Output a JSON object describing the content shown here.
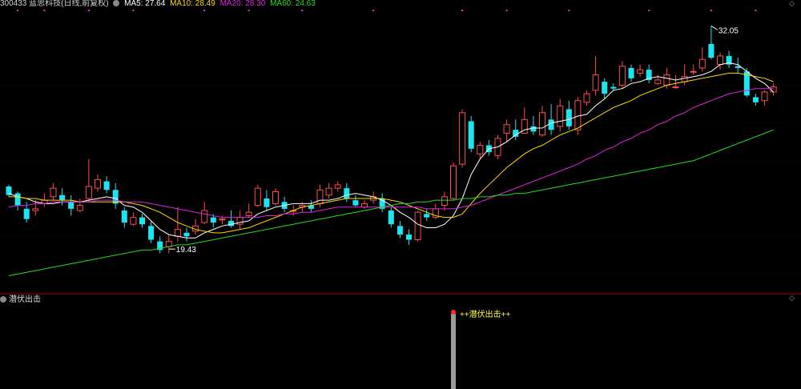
{
  "header": {
    "code_name": "300433 蓝思科技(日线,前复权)",
    "ma5_label": "MA5: 27.64",
    "ma10_label": "MA10: 28.49",
    "ma20_label": "MA20: 28.30",
    "ma60_label": "MA60: 24.63"
  },
  "sub_header": {
    "indicator_name": "潜伏出击"
  },
  "colors": {
    "up": "#ff4b4b",
    "down": "#19e6f0",
    "ma5": "#ffffff",
    "ma10": "#ffd800",
    "ma20": "#e020e0",
    "ma60": "#22dd22",
    "grid": "#4a0000",
    "signal": "#ffff30",
    "bar": "#9a9a9a",
    "marker": "#d040d0"
  },
  "chart_data": [
    {
      "type": "candlestick",
      "title": "300433 蓝思科技(日线,前复权)",
      "ylim": [
        16.5,
        33.0
      ],
      "annotations": [
        {
          "label": "32.05",
          "index": 79,
          "value": 32.05
        },
        {
          "label": "19.43",
          "index": 18,
          "value": 19.43
        }
      ],
      "series": [
        {
          "name": "K",
          "candles": [
            [
              22.7,
              22.7,
              22.2,
              22.1,
              22.8
            ],
            [
              22.2,
              22.3,
              21.6,
              21.3,
              22.4
            ],
            [
              21.6,
              21.4,
              20.8,
              20.6,
              21.8
            ],
            [
              21.2,
              21.3,
              21.4,
              21.0,
              21.9
            ],
            [
              21.4,
              21.7,
              21.9,
              21.5,
              22.3
            ],
            [
              21.8,
              22.1,
              22.6,
              21.9,
              22.9
            ],
            [
              22.4,
              22.2,
              21.9,
              21.6,
              22.6
            ],
            [
              22.1,
              21.8,
              21.4,
              21.0,
              22.2
            ],
            [
              21.7,
              21.3,
              21.6,
              21.2,
              22.0
            ],
            [
              21.9,
              22.0,
              22.7,
              21.8,
              24.3
            ],
            [
              22.5,
              22.6,
              23.1,
              22.4,
              23.4
            ],
            [
              23.2,
              23.0,
              22.5,
              22.3,
              23.3
            ],
            [
              22.7,
              22.5,
              21.7,
              21.4,
              22.9
            ],
            [
              21.7,
              21.3,
              20.6,
              20.3,
              21.5
            ],
            [
              20.7,
              20.5,
              20.9,
              20.4,
              21.2
            ],
            [
              21.0,
              20.9,
              20.5,
              20.3,
              21.1
            ],
            [
              20.5,
              20.4,
              19.6,
              19.4,
              20.7
            ],
            [
              19.7,
              19.5,
              19.0,
              18.8,
              19.8
            ],
            [
              19.3,
              19.2,
              19.5,
              18.8,
              19.9
            ],
            [
              19.6,
              19.8,
              20.2,
              19.5,
              21.5
            ],
            [
              20.1,
              20.0,
              19.8,
              19.5,
              20.3
            ],
            [
              20.0,
              20.1,
              20.4,
              19.9,
              20.8
            ],
            [
              20.4,
              20.6,
              21.3,
              20.5,
              21.8
            ],
            [
              21.0,
              20.9,
              20.6,
              20.3,
              21.1
            ],
            [
              20.7,
              20.8,
              20.8,
              20.5,
              21.0
            ],
            [
              20.8,
              20.7,
              20.4,
              20.3,
              21.3
            ],
            [
              20.8,
              20.5,
              20.9,
              20.2,
              21.3
            ],
            [
              20.9,
              21.0,
              21.2,
              20.9,
              21.7
            ],
            [
              21.2,
              21.6,
              22.6,
              21.5,
              22.8
            ],
            [
              22.3,
              22.0,
              21.5,
              21.3,
              22.5
            ],
            [
              21.6,
              21.7,
              22.4,
              21.6,
              22.6
            ],
            [
              22.2,
              21.8,
              21.4,
              21.2,
              22.1
            ],
            [
              21.5,
              21.3,
              21.3,
              21.0,
              21.6
            ],
            [
              21.4,
              21.5,
              21.6,
              21.2,
              21.8
            ],
            [
              21.7,
              21.6,
              21.4,
              21.2,
              21.9
            ],
            [
              21.5,
              21.7,
              22.5,
              21.5,
              22.8
            ],
            [
              22.3,
              22.2,
              22.6,
              22.0,
              22.9
            ],
            [
              22.6,
              22.6,
              22.8,
              22.4,
              23.0
            ],
            [
              22.7,
              22.6,
              22.0,
              21.8,
              22.9
            ],
            [
              22.0,
              21.9,
              21.6,
              21.5,
              22.2
            ],
            [
              21.6,
              21.5,
              21.7,
              21.4,
              21.9
            ],
            [
              21.8,
              21.9,
              22.1,
              21.7,
              22.4
            ],
            [
              22.1,
              22.0,
              21.4,
              21.2,
              22.3
            ],
            [
              21.4,
              21.3,
              20.5,
              20.3,
              21.5
            ],
            [
              20.6,
              20.4,
              19.9,
              19.7,
              20.7
            ],
            [
              19.8,
              19.9,
              19.6,
              19.3,
              20.2
            ],
            [
              19.9,
              19.6,
              21.2,
              19.5,
              21.3
            ],
            [
              21.2,
              21.1,
              20.9,
              20.7,
              21.4
            ],
            [
              20.9,
              20.9,
              21.4,
              20.8,
              21.7
            ],
            [
              21.5,
              21.6,
              22.1,
              21.3,
              22.4
            ],
            [
              22.1,
              22.0,
              23.9,
              21.9,
              24.1
            ],
            [
              23.9,
              24.0,
              27.0,
              23.8,
              27.2
            ],
            [
              26.7,
              26.5,
              24.9,
              24.7,
              26.8
            ],
            [
              24.9,
              24.6,
              25.1,
              24.3,
              25.3
            ],
            [
              24.9,
              25.1,
              24.7,
              24.5,
              25.4
            ],
            [
              24.6,
              24.5,
              25.5,
              24.3,
              25.7
            ],
            [
              25.4,
              25.8,
              26.3,
              25.3,
              26.6
            ],
            [
              26.3,
              26.0,
              25.6,
              25.4,
              26.6
            ],
            [
              25.6,
              25.8,
              26.6,
              25.8,
              27.3
            ],
            [
              26.6,
              26.2,
              25.9,
              25.7,
              26.8
            ],
            [
              25.8,
              25.7,
              27.0,
              25.6,
              27.4
            ],
            [
              27.1,
              26.6,
              26.0,
              25.7,
              27.5
            ],
            [
              26.1,
              26.2,
              27.4,
              25.9,
              27.8
            ],
            [
              27.4,
              27.2,
              26.2,
              26.0,
              27.7
            ],
            [
              26.3,
              26.0,
              27.7,
              25.7,
              27.9
            ],
            [
              27.8,
              27.6,
              28.1,
              27.4,
              28.3
            ],
            [
              28.1,
              28.3,
              29.2,
              28.0,
              30.3
            ],
            [
              28.9,
              28.8,
              28.1,
              27.8,
              29.0
            ],
            [
              28.5,
              28.5,
              28.4,
              28.3,
              28.7
            ],
            [
              28.8,
              28.6,
              29.7,
              28.4,
              30.0
            ],
            [
              29.5,
              29.6,
              29.0,
              28.8,
              29.8
            ],
            [
              29.2,
              29.3,
              29.5,
              29.1,
              29.8
            ],
            [
              29.6,
              29.5,
              28.9,
              28.7,
              29.8
            ],
            [
              28.9,
              28.7,
              28.9,
              28.6,
              29.2
            ],
            [
              28.8,
              28.6,
              29.2,
              28.4,
              29.6
            ],
            [
              28.6,
              28.5,
              28.5,
              28.4,
              29.2
            ],
            [
              28.8,
              28.8,
              29.1,
              28.6,
              29.8
            ],
            [
              29.5,
              29.4,
              29.4,
              29.2,
              29.8
            ],
            [
              29.6,
              29.6,
              30.1,
              29.4,
              30.8
            ],
            [
              30.9,
              31.0,
              30.2,
              30.1,
              32.05
            ],
            [
              29.7,
              29.8,
              30.3,
              29.5,
              30.5
            ],
            [
              30.4,
              30.3,
              29.8,
              29.6,
              30.6
            ],
            [
              29.9,
              29.7,
              29.6,
              29.3,
              30.2
            ],
            [
              29.5,
              29.4,
              28.0,
              27.9,
              29.6
            ],
            [
              28.0,
              27.9,
              27.6,
              27.4,
              28.1
            ],
            [
              27.8,
              27.7,
              28.2,
              27.4,
              28.3
            ],
            [
              28.3,
              28.2,
              28.5,
              28.0,
              28.7
            ]
          ]
        },
        {
          "name": "MA5",
          "values": [
            22.3,
            22.1,
            22.0,
            21.8,
            21.7,
            21.7,
            21.8,
            21.8,
            21.8,
            21.9,
            22.0,
            22.1,
            22.0,
            21.6,
            21.5,
            21.2,
            20.7,
            20.2,
            19.9,
            19.8,
            19.7,
            19.7,
            20.0,
            20.2,
            20.4,
            20.5,
            20.6,
            20.7,
            21.1,
            21.3,
            21.5,
            21.6,
            21.7,
            21.7,
            21.7,
            21.9,
            21.9,
            22.0,
            22.2,
            22.3,
            22.2,
            22.1,
            21.9,
            21.6,
            21.2,
            20.9,
            20.5,
            20.3,
            20.3,
            20.5,
            21.0,
            22.0,
            23.4,
            24.3,
            24.9,
            25.0,
            25.3,
            25.7,
            26.0,
            26.1,
            26.1,
            26.4,
            26.5,
            26.6,
            26.8,
            26.9,
            27.4,
            27.8,
            28.3,
            28.4,
            28.7,
            28.8,
            29.0,
            29.1,
            29.0,
            28.9,
            29.0,
            29.1,
            29.2,
            29.4,
            29.8,
            29.9,
            29.8,
            29.4,
            29.0,
            28.7,
            28.2
          ]
        },
        {
          "name": "MA10",
          "values": [
            22.1,
            22.1,
            22.0,
            22.0,
            21.9,
            21.9,
            21.9,
            21.9,
            21.8,
            21.8,
            21.8,
            21.8,
            21.8,
            21.8,
            21.7,
            21.6,
            21.4,
            21.2,
            20.9,
            20.6,
            20.4,
            20.2,
            20.1,
            20.0,
            20.0,
            20.1,
            20.2,
            20.3,
            20.5,
            20.7,
            20.9,
            21.1,
            21.3,
            21.5,
            21.6,
            21.7,
            21.8,
            21.9,
            22.0,
            22.0,
            22.0,
            22.0,
            22.0,
            21.9,
            21.8,
            21.6,
            21.4,
            21.2,
            21.0,
            20.9,
            20.9,
            21.1,
            21.7,
            22.3,
            22.8,
            23.3,
            23.8,
            24.2,
            24.6,
            24.9,
            25.1,
            25.4,
            25.7,
            25.9,
            26.1,
            26.4,
            26.7,
            27.0,
            27.3,
            27.5,
            27.7,
            28.0,
            28.2,
            28.4,
            28.6,
            28.7,
            28.8,
            28.9,
            29.0,
            29.1,
            29.2,
            29.3,
            29.3,
            29.2,
            29.1,
            29.0,
            28.8
          ]
        },
        {
          "name": "MA20",
          "values": [
            21.5,
            21.6,
            21.6,
            21.7,
            21.7,
            21.8,
            21.8,
            21.8,
            21.8,
            21.8,
            21.9,
            21.9,
            21.9,
            21.8,
            21.8,
            21.8,
            21.7,
            21.6,
            21.5,
            21.4,
            21.3,
            21.2,
            21.1,
            21.0,
            20.9,
            20.9,
            20.9,
            20.9,
            20.9,
            21.0,
            21.0,
            21.1,
            21.1,
            21.2,
            21.2,
            21.3,
            21.4,
            21.5,
            21.5,
            21.5,
            21.5,
            21.5,
            21.5,
            21.5,
            21.5,
            21.5,
            21.5,
            21.4,
            21.4,
            21.4,
            21.4,
            21.5,
            21.6,
            21.8,
            22.0,
            22.2,
            22.4,
            22.6,
            22.8,
            23.0,
            23.2,
            23.4,
            23.6,
            23.8,
            24.0,
            24.3,
            24.5,
            24.8,
            25.0,
            25.3,
            25.5,
            25.8,
            26.0,
            26.3,
            26.5,
            26.8,
            27.0,
            27.3,
            27.5,
            27.7,
            27.9,
            28.1,
            28.2,
            28.3,
            28.4,
            28.4,
            28.4
          ]
        },
        {
          "name": "MA60",
          "values": [
            17.5,
            17.6,
            17.7,
            17.8,
            17.9,
            18.0,
            18.1,
            18.2,
            18.3,
            18.4,
            18.5,
            18.6,
            18.7,
            18.8,
            18.9,
            19.0,
            19.0,
            19.1,
            19.2,
            19.3,
            19.3,
            19.4,
            19.5,
            19.6,
            19.7,
            19.8,
            19.9,
            20.0,
            20.1,
            20.2,
            20.3,
            20.4,
            20.5,
            20.6,
            20.7,
            20.8,
            20.9,
            21.0,
            21.1,
            21.2,
            21.3,
            21.4,
            21.5,
            21.6,
            21.7,
            21.7,
            21.8,
            21.8,
            21.9,
            21.9,
            21.9,
            22.0,
            22.0,
            22.1,
            22.1,
            22.2,
            22.2,
            22.3,
            22.3,
            22.4,
            22.5,
            22.6,
            22.7,
            22.8,
            22.9,
            23.0,
            23.1,
            23.2,
            23.3,
            23.4,
            23.5,
            23.6,
            23.7,
            23.8,
            23.9,
            24.0,
            24.1,
            24.2,
            24.4,
            24.6,
            24.8,
            25.0,
            25.2,
            25.4,
            25.6,
            25.8,
            26.0
          ]
        }
      ]
    },
    {
      "type": "bar",
      "title": "潜伏出击",
      "signals": [
        {
          "index": 50,
          "label": "++潜伏出击++"
        }
      ]
    }
  ]
}
